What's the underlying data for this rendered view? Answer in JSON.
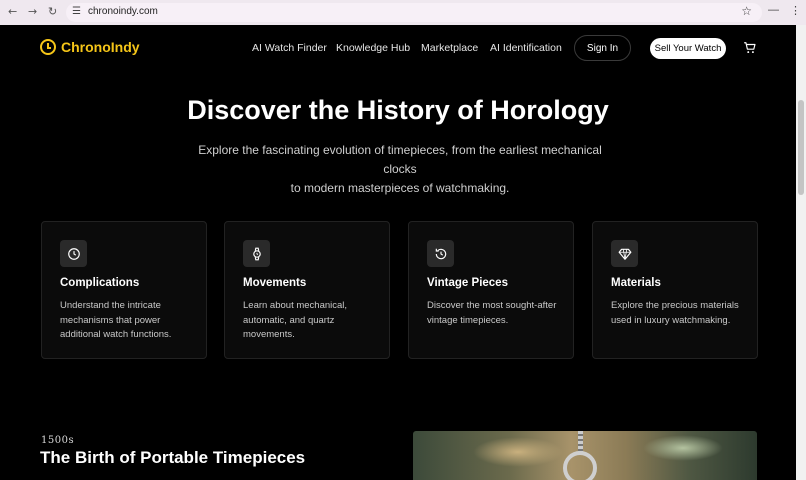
{
  "browser": {
    "url": "chronoindy.com",
    "back_icon": "arrow-left-icon",
    "forward_icon": "arrow-right-icon",
    "reload_icon": "reload-icon"
  },
  "header": {
    "logo_text": "ChronoIndy",
    "nav": [
      "AI Watch Finder",
      "Knowledge Hub",
      "Marketplace",
      "AI Identification"
    ],
    "signin_label": "Sign In",
    "sell_label": "Sell Your Watch"
  },
  "hero": {
    "title": "Discover the History of Horology",
    "subtitle_line1": "Explore the fascinating evolution of timepieces, from the earliest mechanical clocks",
    "subtitle_line2": "to modern masterpieces of watchmaking."
  },
  "cards": [
    {
      "icon": "clock-icon",
      "title": "Complications",
      "desc": "Understand the intricate mechanisms that power additional watch functions."
    },
    {
      "icon": "watch-icon",
      "title": "Movements",
      "desc": "Learn about mechanical, automatic, and quartz movements."
    },
    {
      "icon": "history-icon",
      "title": "Vintage Pieces",
      "desc": "Discover the most sought-after vintage timepieces."
    },
    {
      "icon": "gem-icon",
      "title": "Materials",
      "desc": "Explore the precious materials used in luxury watchmaking."
    }
  ],
  "section": {
    "era": "1500s",
    "title": "The Birth of Portable Timepieces"
  },
  "colors": {
    "accent": "#f5c518",
    "background": "#000000",
    "card_bg": "#0b0b0b"
  }
}
